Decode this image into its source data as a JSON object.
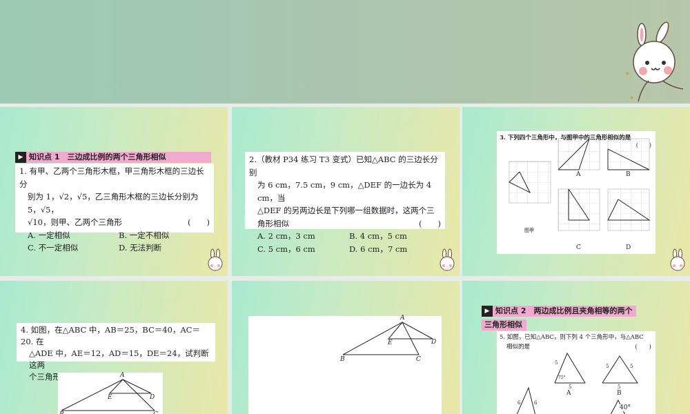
{
  "slide1": {
    "kp_label": "知识点 1",
    "kp_title": "三边成比例的两个三角形相似",
    "q_lines": [
      "1. 有甲、乙两个三角形木框，甲三角形木框的三边长分",
      "别为 1，√2，√5，乙三角形木框的三边长分别为 5，√5，",
      "√10，则甲、乙两个三角形"
    ],
    "paren": "(　　)",
    "options": [
      "A. 一定相似",
      "B. 一定不相似",
      "C. 不一定相似",
      "D. 无法判断"
    ]
  },
  "slide2": {
    "q_lines": [
      "2.（教材 P34 练习 T3 变式）已知△ABC 的三边长分别",
      "为 6 cm，7.5 cm，9 cm，△DEF 的一边长为 4 cm，当",
      "△DEF 的另两边长是下列哪一组数据时，这两个三",
      "角形相似"
    ],
    "paren": "(　　)",
    "options": [
      "A. 2 cm，3 cm",
      "B. 4 cm，5 cm",
      "C. 5 cm，6 cm",
      "D. 6 cm，7 cm"
    ]
  },
  "slide3": {
    "question": "3. 下列四个三角形中，与图甲中的三角形相似的是",
    "paren": "(　　)",
    "fig_main": "图甲",
    "labels": [
      "A",
      "B",
      "C",
      "D"
    ]
  },
  "slide4": {
    "q_lines": [
      "4. 如图，在△ABC 中，AB＝25，BC＝40，AC＝20. 在",
      "△ADE 中，AE＝12，AD＝15，DE＝24，试判断这两",
      "个三角形是否相似，并说明理由."
    ],
    "points": [
      "A",
      "B",
      "C",
      "D",
      "E"
    ]
  },
  "slide5": {
    "points": [
      "A",
      "B",
      "C",
      "D",
      "E"
    ]
  },
  "slide6": {
    "kp_label": "知识点 2",
    "kp_title_1": "两边成比例且夹角相等的两个",
    "kp_title_2": "三角形相似",
    "q_lines": [
      "5. 如图，已知△ABC，则下列 4 个三角形中，与△ABC",
      "相似的是"
    ],
    "paren": "(　　)",
    "tri_labels": [
      "A",
      "B"
    ],
    "side_5": "5",
    "side_6": "6",
    "angle_75": "75°",
    "angle_40": "40°"
  }
}
